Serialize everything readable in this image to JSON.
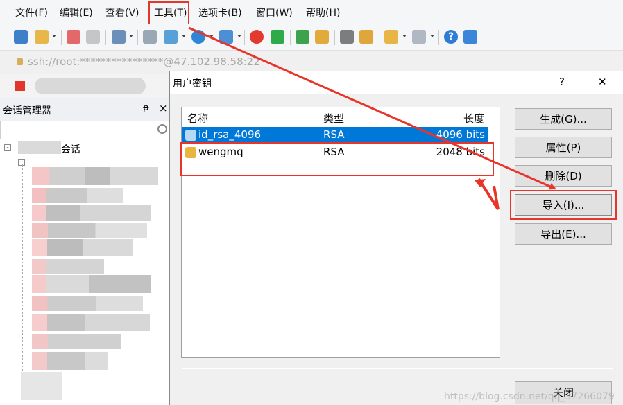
{
  "menu": [
    "文件(F)",
    "编辑(E)",
    "查看(V)",
    "工具(T)",
    "选项卡(B)",
    "窗口(W)",
    "帮助(H)"
  ],
  "address": "ssh://root:****************@47.102.98.58:22",
  "session_manager": {
    "title": "会话管理器",
    "pin_glyph": "ᵽ",
    "close_glyph": "×",
    "root_label": "会话"
  },
  "dialog": {
    "title": "用户密钥",
    "help": "?",
    "close": "✕",
    "columns": {
      "name": "名称",
      "type": "类型",
      "length": "长度"
    },
    "keys": [
      {
        "name": "id_rsa_4096",
        "type": "RSA",
        "length": "4096 bits",
        "selected": true
      },
      {
        "name": "wengmq",
        "type": "RSA",
        "length": "2048 bits",
        "selected": false
      }
    ],
    "buttons": {
      "generate": "生成(G)...",
      "properties": "属性(P)",
      "delete": "删除(D)",
      "import": "导入(I)...",
      "export": "导出(E)...",
      "close": "关闭"
    }
  },
  "watermark": "https://blog.csdn.net/qq_37266079",
  "colors": {
    "annotation_red": "#e8352b",
    "selection_blue": "#0078d7",
    "menu_bg": "#f5f6f7"
  },
  "icons": [
    "new-session-icon",
    "open-folder-icon",
    "connect-icon",
    "disconnect-icon",
    "properties-icon",
    "find-icon",
    "transfer-icon",
    "globe-icon",
    "font-icon",
    "xftp-icon",
    "xshell-icon",
    "fullscreen-icon",
    "lock-icon",
    "keyboard-icon",
    "pen-icon",
    "add-icon",
    "layout-icon",
    "help-icon",
    "chat-icon"
  ]
}
